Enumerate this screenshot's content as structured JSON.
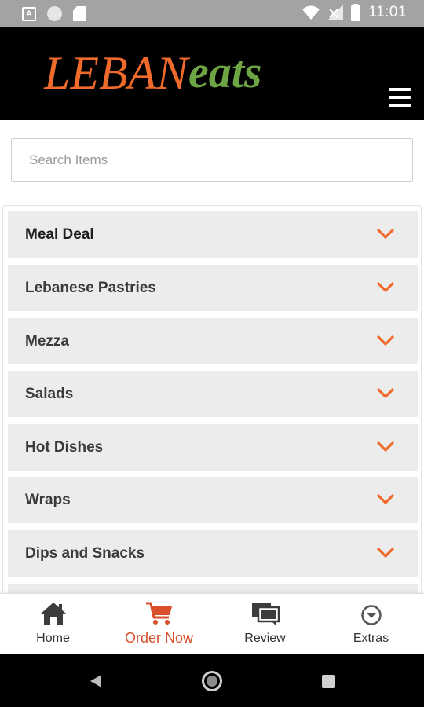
{
  "status_bar": {
    "time": "11:01",
    "icons": [
      "a-notification-icon",
      "circle-notification-icon",
      "sd-card-icon",
      "wifi-icon",
      "signal-icon",
      "battery-icon"
    ]
  },
  "header": {
    "logo_text_primary": "LEBAN",
    "logo_text_secondary": "eats",
    "logo_colors": {
      "primary": "#f06a2c",
      "secondary": "#6ea544"
    },
    "menu_icon": "hamburger-menu-icon"
  },
  "search": {
    "placeholder": "Search Items",
    "value": ""
  },
  "categories": [
    {
      "label": "Meal Deal"
    },
    {
      "label": "Lebanese Pastries"
    },
    {
      "label": "Mezza"
    },
    {
      "label": "Salads"
    },
    {
      "label": "Hot Dishes"
    },
    {
      "label": "Wraps"
    },
    {
      "label": "Dips and Snacks"
    }
  ],
  "bottom_nav": [
    {
      "label": "Home",
      "icon": "home-icon",
      "active": false
    },
    {
      "label": "Order Now",
      "icon": "cart-icon",
      "active": true
    },
    {
      "label": "Review",
      "icon": "chat-bubbles-icon",
      "active": false
    },
    {
      "label": "Extras",
      "icon": "chevron-circle-down-icon",
      "active": false
    }
  ],
  "colors": {
    "accent": "#f06a2c",
    "active_nav": "#d9502b",
    "header_bg": "#000000",
    "category_bg": "#ececec"
  }
}
